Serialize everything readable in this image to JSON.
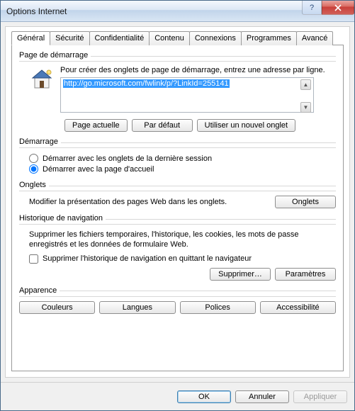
{
  "window": {
    "title": "Options Internet"
  },
  "tabs": {
    "items": [
      {
        "label": "Général"
      },
      {
        "label": "Sécurité"
      },
      {
        "label": "Confidentialité"
      },
      {
        "label": "Contenu"
      },
      {
        "label": "Connexions"
      },
      {
        "label": "Programmes"
      },
      {
        "label": "Avancé"
      }
    ],
    "active_index": 0
  },
  "homepage": {
    "legend": "Page de démarrage",
    "description": "Pour créer des onglets de page de démarrage, entrez une adresse par ligne.",
    "value": "http://go.microsoft.com/fwlink/p/?LinkId=255141",
    "buttons": {
      "current": "Page actuelle",
      "default": "Par défaut",
      "newtab": "Utiliser un nouvel onglet"
    }
  },
  "startup": {
    "legend": "Démarrage",
    "opt_last_session": "Démarrer avec les onglets de la dernière session",
    "opt_home": "Démarrer avec la page d'accueil",
    "selected": "home"
  },
  "tabs_group": {
    "legend": "Onglets",
    "description": "Modifier la présentation des pages Web dans les onglets.",
    "button": "Onglets"
  },
  "history": {
    "legend": "Historique de navigation",
    "description": "Supprimer les fichiers temporaires, l'historique, les cookies, les mots de passe enregistrés et les données de formulaire Web.",
    "checkbox": "Supprimer l'historique de navigation en quittant le navigateur",
    "checked": false,
    "buttons": {
      "delete": "Supprimer…",
      "settings": "Paramètres"
    }
  },
  "appearance": {
    "legend": "Apparence",
    "buttons": {
      "colors": "Couleurs",
      "languages": "Langues",
      "fonts": "Polices",
      "accessibility": "Accessibilité"
    }
  },
  "footer": {
    "ok": "OK",
    "cancel": "Annuler",
    "apply": "Appliquer"
  }
}
